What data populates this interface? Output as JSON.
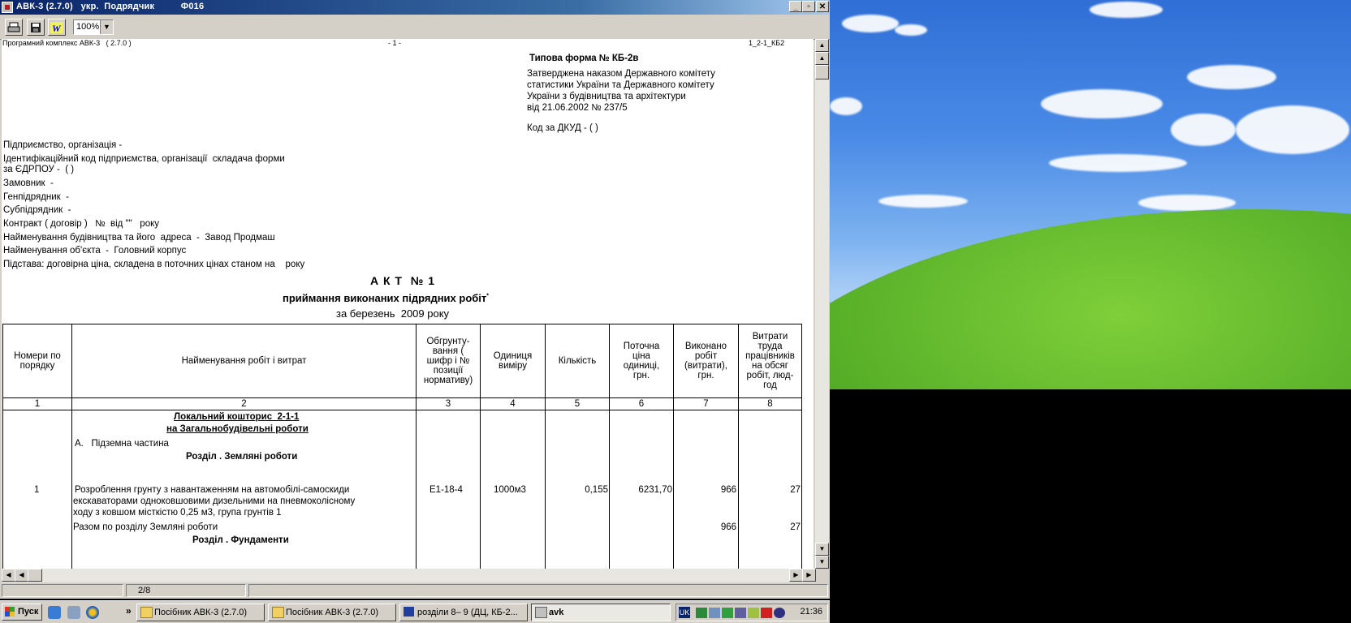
{
  "window": {
    "title": "АВК-3 (2.7.0)   укр.  Подрядчик          Ф016",
    "minimize": "_",
    "maximize": "▫",
    "close": "✕"
  },
  "toolbar": {
    "print_icon": "printer-icon",
    "save_icon": "save-icon",
    "word_icon": "word-export-icon",
    "zoom_value": "100%"
  },
  "doc": {
    "header_left": "Програмний комплекс АВК-3   ( 2.7.0 )",
    "header_center": "- 1 -",
    "header_right": "1_2-1_КБ2",
    "form_title": "Типова форма № КБ-2в",
    "approved": [
      "Затверджена наказом Державного комітету",
      "статистики України та Державного комітету",
      "України з будівництва та архітектури",
      "від 21.06.2002 № 237/5"
    ],
    "dkud": "Код за ДКУД - ( )",
    "info_lines": [
      "Підприємство, організація -",
      "Ідентифікаційний код підприємства, організації  складача форми",
      "за ЄДРПОУ -  ( )",
      "Замовник  -",
      "Генпідрядник  -",
      "Субпідрядник  -",
      "Контракт ( договір )   №  від \"\"   року",
      "Найменування будівництва та його  адреса  -  Завод Продмаш",
      "Найменування об'єкта  -  Головний корпус",
      "Підстава: договірна ціна, складена в поточних цінах станом на    року"
    ],
    "act_title": "А К Т  № 1",
    "act_subtitle": "приймання виконаних підрядних робіт",
    "act_star": "*",
    "act_period": "за березень  2009 року"
  },
  "table": {
    "headers": [
      "Номери по порядку",
      "Найменування робіт і витрат",
      "Обгрунту-вання ( шифр і № позиції нормативу)",
      "Одиниця виміру",
      "Кількість",
      "Поточна ціна одиниці, грн.",
      "Виконано робіт (витрати), грн.",
      "Витрати труда працівників на обсяг робіт, люд-год"
    ],
    "col_numbers": [
      "1",
      "2",
      "3",
      "4",
      "5",
      "6",
      "7",
      "8"
    ],
    "local_estimate_1": "Локальний кошторис  2-1-1",
    "local_estimate_2": "на Загальнобудівельні роботи",
    "section_a": "А.   Підземна частина",
    "section_earth": "Розділ . Земляні роботи",
    "row1": {
      "num": "1",
      "name_lines": [
        "Розроблення грунту з навантаженням на автомобілі-самоскиди",
        "екскаваторами одноковшовими дизельними на пневмоколісному",
        "ходу з ковшом місткістю 0,25 м3, група грунтів 1"
      ],
      "code": "Е1-18-4",
      "unit": "1000м3",
      "qty": "0,155",
      "price": "6231,70",
      "done": "966",
      "labor": "27"
    },
    "subtotal": {
      "label": "Разом по розділу Земляні роботи",
      "done": "966",
      "labor": "27"
    },
    "section_foundation": "Розділ . Фундаменти"
  },
  "status": {
    "page": "2/8"
  },
  "taskbar": {
    "start": "Пуск",
    "tasks": [
      "Посібник АВК-3 (2.7.0)",
      "Посібник АВК-3 (2.7.0)",
      "розділи 8– 9 (ДЦ, КБ-2...",
      "avk"
    ],
    "overflow": "»",
    "lang": "UK",
    "time": "21:36"
  }
}
